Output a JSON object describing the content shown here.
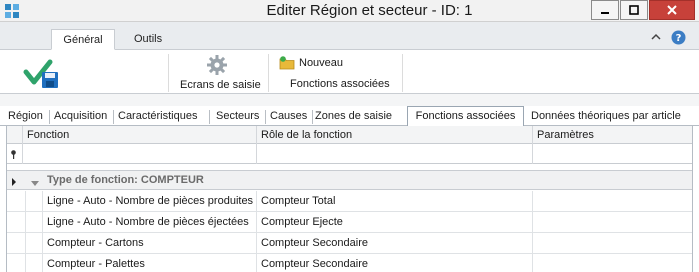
{
  "window": {
    "title": "Editer Région et secteur - ID: 1"
  },
  "ribbon": {
    "tabs": [
      {
        "label": "Général",
        "active": true
      },
      {
        "label": "Outils",
        "active": false
      }
    ],
    "ecrans_label": "Ecrans de saisie",
    "nouveau_label": "Nouveau",
    "fonctions_group_label": "Fonctions associées"
  },
  "page_tabs": [
    {
      "label": "Région"
    },
    {
      "label": "Acquisition"
    },
    {
      "label": "Caractéristiques"
    },
    {
      "label": "Secteurs"
    },
    {
      "label": "Causes"
    },
    {
      "label": "Zones de saisie"
    },
    {
      "label": "Fonctions associées",
      "active": true
    },
    {
      "label": "Données théoriques par article"
    }
  ],
  "grid": {
    "columns": [
      "Fonction",
      "Rôle de la fonction",
      "Paramètres"
    ],
    "group_label": "Type de fonction: COMPTEUR",
    "rows": [
      {
        "fonction": "Ligne - Auto - Nombre de pièces produites",
        "role": "Compteur Total",
        "params": ""
      },
      {
        "fonction": "Ligne - Auto - Nombre de pièces éjectées",
        "role": "Compteur Ejecte",
        "params": ""
      },
      {
        "fonction": "Compteur - Cartons",
        "role": "Compteur Secondaire",
        "params": ""
      },
      {
        "fonction": "Compteur - Palettes",
        "role": "Compteur Secondaire",
        "params": ""
      }
    ]
  },
  "colors": {
    "accent_green": "#2fa36b",
    "accent_blue": "#1f6fbf",
    "close_red": "#c7413a"
  },
  "icons": {
    "app": "app-grid-icon",
    "save": "save-check-icon",
    "ecrans": "gear-icon",
    "nouveau": "new-folder-icon",
    "help": "help-icon",
    "collapse": "chevron-up-icon",
    "filter": "filter-pin-icon"
  }
}
